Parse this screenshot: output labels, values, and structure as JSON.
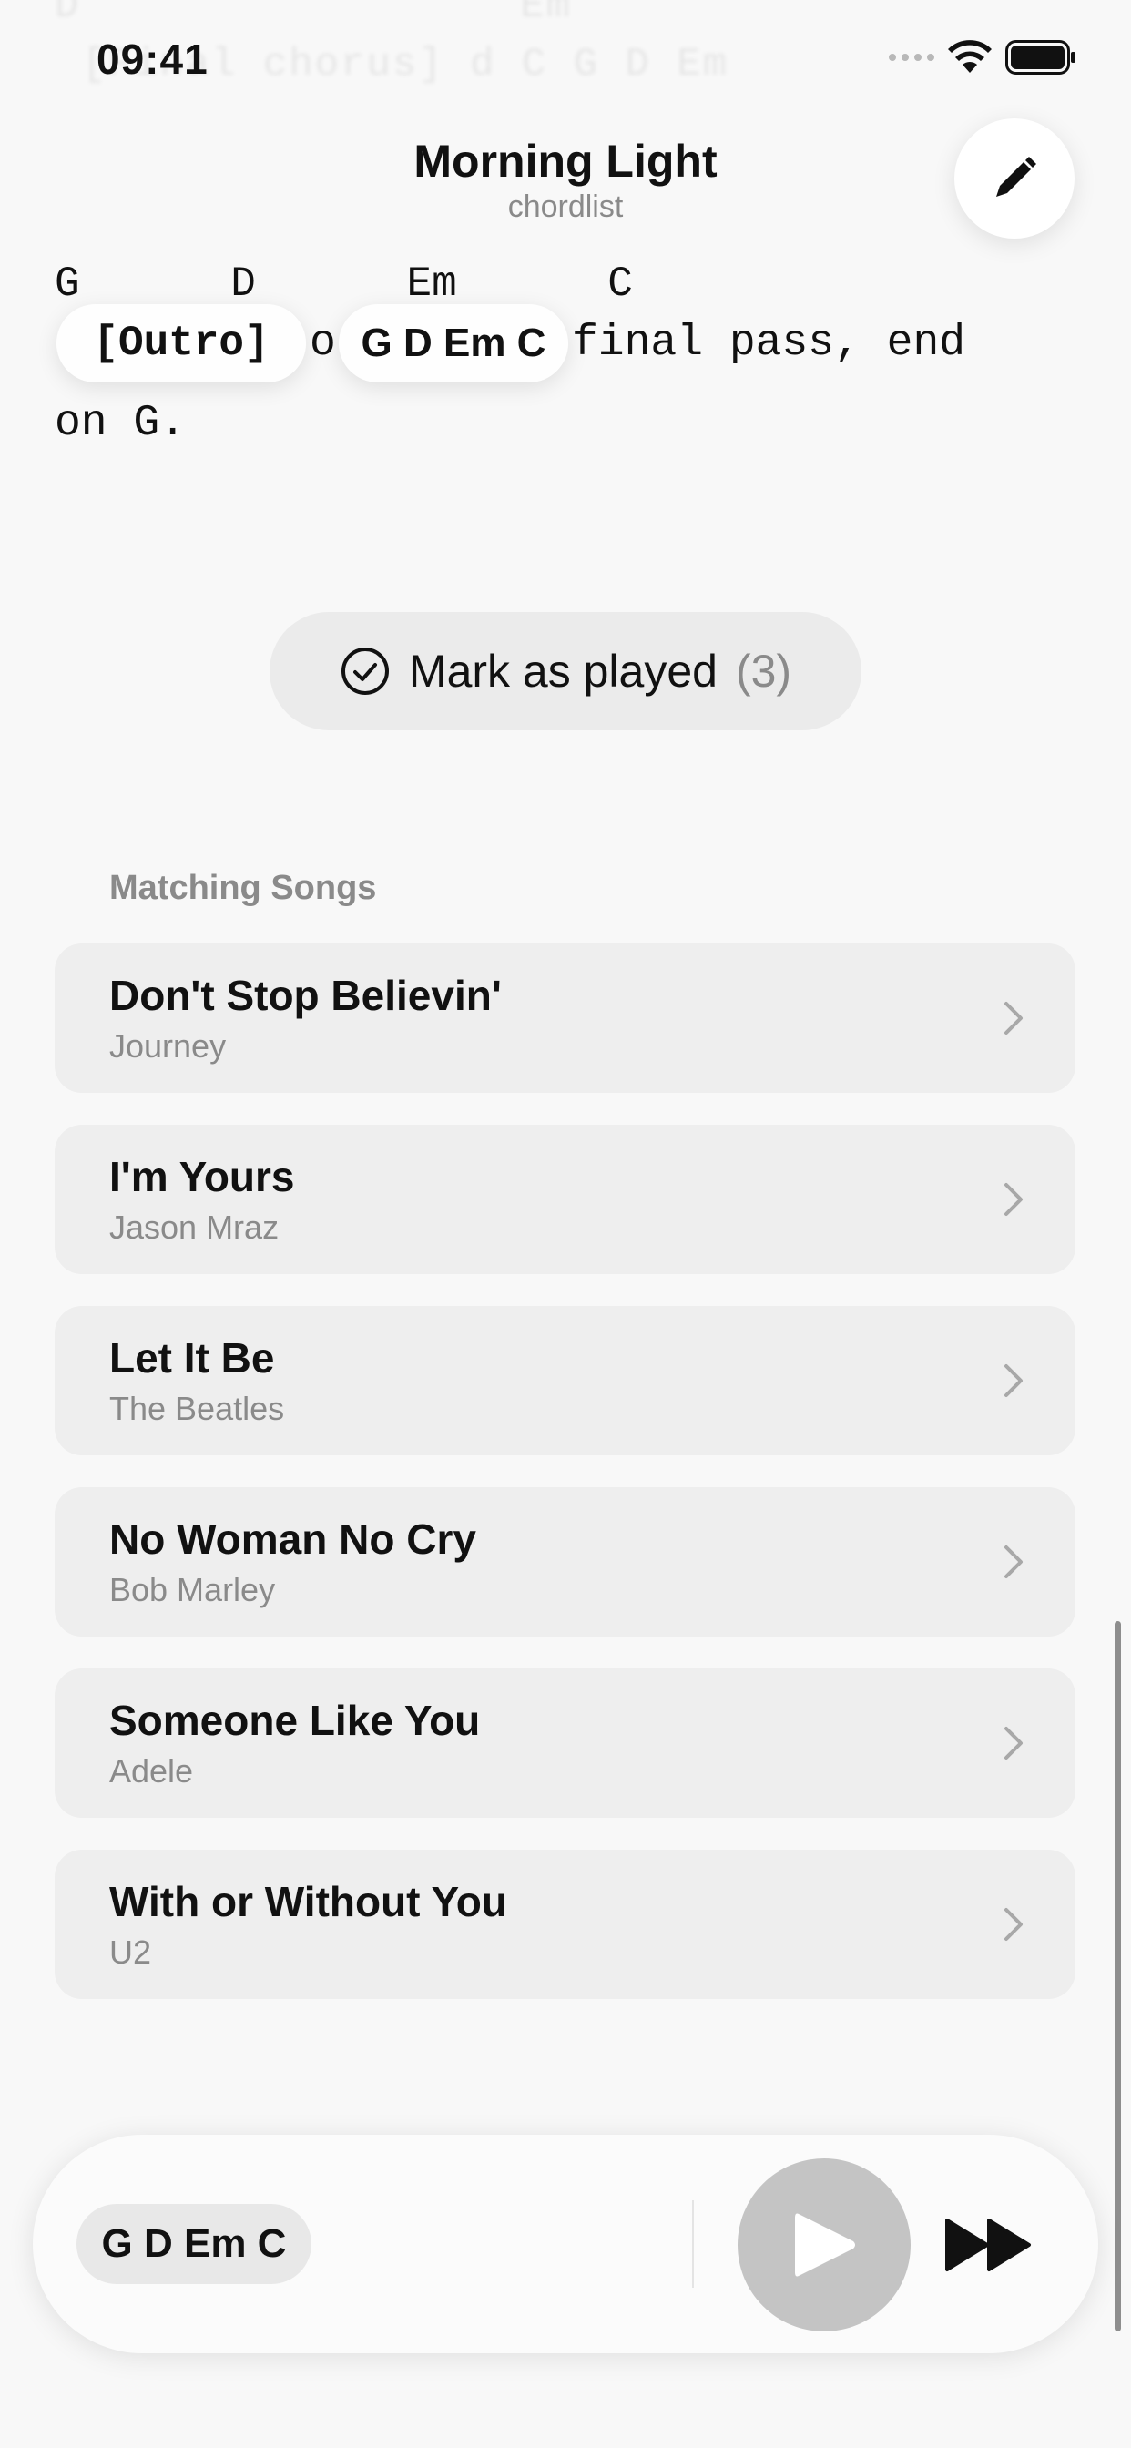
{
  "status_bar": {
    "time": "09:41"
  },
  "background_ghost": {
    "line1": "D                 Em",
    "line2": "[Final chorus] d C G D Em"
  },
  "header": {
    "title": "Morning Light",
    "subtitle": "chordlist",
    "edit_icon": "pencil-icon"
  },
  "content": {
    "chord_line": "G      D      Em      C",
    "tag": "[Outro]",
    "lyric_fragment_1": "o",
    "chord_pill": "G D Em C",
    "lyric_fragment_2": "final pass, end",
    "lyric_line_2": "on G."
  },
  "mark_played": {
    "icon": "check-circle-icon",
    "label": "Mark as played",
    "count": "(3)"
  },
  "matching": {
    "label": "Matching Songs",
    "songs": [
      {
        "title": "Don't Stop Believin'",
        "artist": "Journey"
      },
      {
        "title": "I'm Yours",
        "artist": "Jason Mraz"
      },
      {
        "title": "Let It Be",
        "artist": "The Beatles"
      },
      {
        "title": "No Woman No Cry",
        "artist": "Bob Marley"
      },
      {
        "title": "Someone Like You",
        "artist": "Adele"
      },
      {
        "title": "With or Without You",
        "artist": "U2"
      }
    ]
  },
  "player": {
    "chords": "G D Em C",
    "play_icon": "play-icon",
    "forward_icon": "fast-forward-icon"
  }
}
